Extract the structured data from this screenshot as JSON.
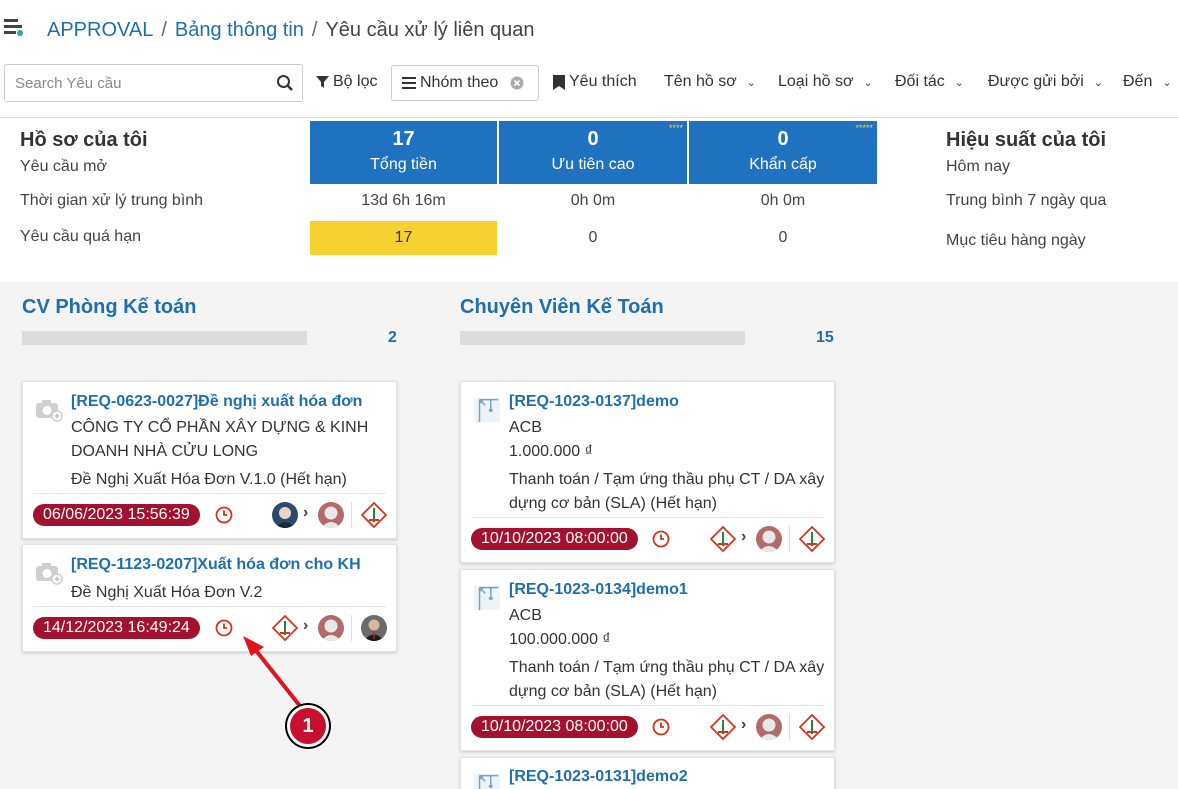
{
  "breadcrumb": {
    "root": "APPROVAL",
    "sep": "/",
    "parent": "Bảng thông tin",
    "current": "Yêu cầu xử lý liên quan"
  },
  "search": {
    "placeholder": "Search Yêu cầu"
  },
  "toolbar": {
    "filter": "Bộ lọc",
    "group_by": "Nhóm theo",
    "favorite": "Yêu thích",
    "profile_name": "Tên hồ sơ",
    "profile_type": "Loại hồ sơ",
    "partner": "Đối tác",
    "sent_by": "Được gửi bởi",
    "to": "Đến"
  },
  "my_records": {
    "title": "Hồ sơ của tôi",
    "open_label": "Yêu cầu mở",
    "avg_label": "Thời gian xử lý trung bình",
    "overdue_label": "Yêu cầu quá hạn",
    "total": {
      "num": "17",
      "label": "Tổng tiền",
      "avg": "13d 6h 16m",
      "overdue": "17"
    },
    "high": {
      "num": "0",
      "label": "Ưu tiên cao",
      "stars": "****",
      "avg": "0h 0m",
      "overdue": "0"
    },
    "urgent": {
      "num": "0",
      "label": "Khẩn cấp",
      "stars": "*****",
      "avg": "0h 0m",
      "overdue": "0"
    }
  },
  "my_performance": {
    "title": "Hiệu suất của tôi",
    "today": "Hôm nay",
    "avg7": "Trung bình 7 ngày qua",
    "daily_target": "Mục tiêu hàng ngày"
  },
  "columns": [
    {
      "title": "CV Phòng Kế toán",
      "count": "2",
      "cards": [
        {
          "title": "[REQ-0623-0027]Đề nghị xuất hóa đơn",
          "lines": [
            "CÔNG TY CỔ PHẦN XÂY DỰNG & KINH",
            "DOANH NHÀ CỬU LONG",
            "Đề Nghị Xuất Hóa Đơn V.1.0 (Hết hạn)"
          ],
          "date": "06/06/2023 15:56:39"
        },
        {
          "title": "[REQ-1123-0207]Xuất hóa đơn cho KH",
          "lines": [
            "Đề Nghị Xuất Hóa Đơn V.2"
          ],
          "date": "14/12/2023 16:49:24"
        }
      ]
    },
    {
      "title": "Chuyên Viên Kế Toán",
      "count": "15",
      "cards": [
        {
          "title": "[REQ-1023-0137]demo",
          "lines": [
            "ACB",
            "1.000.000 ₫",
            "Thanh toán / Tạm ứng thầu phụ CT / DA xây",
            "dựng cơ bản (SLA) (Hết hạn)"
          ],
          "date": "10/10/2023 08:00:00"
        },
        {
          "title": "[REQ-1023-0134]demo1",
          "lines": [
            "ACB",
            "100.000.000 ₫",
            "Thanh toán / Tạm ứng thầu phụ CT / DA xây",
            "dựng cơ bản (SLA) (Hết hạn)"
          ],
          "date": "10/10/2023 08:00:00"
        },
        {
          "title": "[REQ-1023-0131]demo2"
        }
      ]
    }
  ],
  "callout": "1",
  "colors": {
    "accent": "#1f6fb0",
    "tile": "#1f72c0",
    "overdue": "#f7d130",
    "badge": "#a4112d",
    "callout": "#c8102e"
  }
}
